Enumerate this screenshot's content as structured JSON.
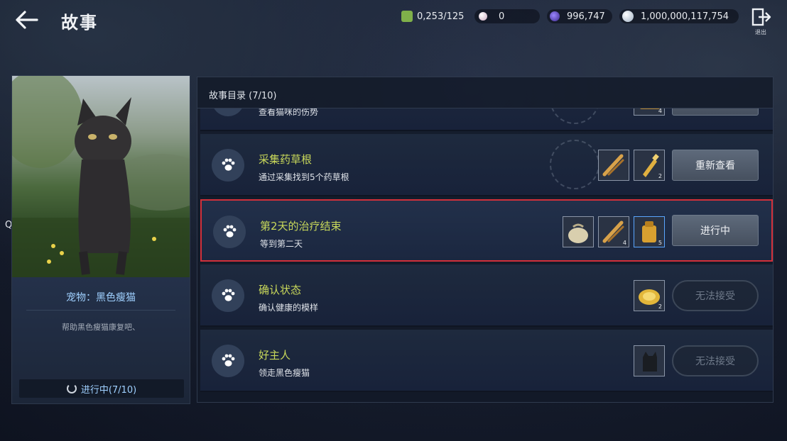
{
  "header": {
    "title": "故事",
    "exit_label": "退出"
  },
  "currencies": [
    {
      "name": "energy",
      "value": "0,253/125",
      "color": "#7fb04a"
    },
    {
      "name": "pearl",
      "value": "0",
      "color": "#d9c6d4"
    },
    {
      "name": "moon-gem",
      "value": "996,747",
      "color": "#6a52c8"
    },
    {
      "name": "silver",
      "value": "1,000,000,117,754",
      "color": "#c9d3de"
    }
  ],
  "qa_label": "QA",
  "pet": {
    "name": "宠物：黑色瘦猫",
    "desc": "帮助黑色瘦猫康复吧、",
    "progress": "进行中(7/10)"
  },
  "story": {
    "header": "故事目录 (7/10)",
    "rows": [
      {
        "title": "",
        "sub": "查看猫咪的伤势",
        "button": "",
        "state": "done",
        "items": [
          {
            "icon": "box-icon",
            "count": "4"
          }
        ]
      },
      {
        "title": "采集药草根",
        "sub": "通过采集找到5个药草根",
        "button": "重新查看",
        "state": "done",
        "items": [
          {
            "icon": "herb-root-icon",
            "count": ""
          },
          {
            "icon": "potion-bottle-icon",
            "count": "2"
          }
        ]
      },
      {
        "title": "第2天的治疗结束",
        "sub": "等到第二天",
        "button": "进行中",
        "state": "active",
        "items": [
          {
            "icon": "sack-icon",
            "count": ""
          },
          {
            "icon": "herb-root-icon",
            "count": "4"
          },
          {
            "icon": "backpack-icon",
            "count": "5"
          }
        ]
      },
      {
        "title": "确认状态",
        "sub": "确认健康的模样",
        "button": "无法接受",
        "state": "locked",
        "items": [
          {
            "icon": "gold-plate-icon",
            "count": "2"
          }
        ]
      },
      {
        "title": "好主人",
        "sub": "领走黑色瘦猫",
        "button": "无法接受",
        "state": "locked",
        "items": [
          {
            "icon": "cat-silhouette-icon",
            "count": ""
          }
        ]
      }
    ]
  }
}
